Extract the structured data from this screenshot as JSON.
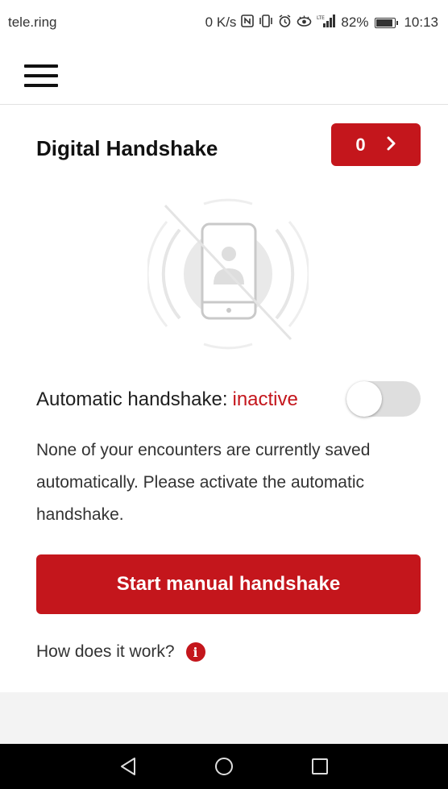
{
  "status_bar": {
    "carrier": "tele.ring",
    "speed": "0 K/s",
    "battery": "82%",
    "time": "10:13",
    "icons": [
      "nfc-icon",
      "vibrate-icon",
      "alarm-icon",
      "eye-comfort-icon",
      "lte-signal-icon",
      "battery-icon"
    ]
  },
  "app_bar": {
    "menu_icon": "hamburger-menu-icon"
  },
  "main": {
    "title": "Digital Handshake",
    "counter": "0",
    "counter_icon": "chevron-right-icon",
    "illustration_icon": "phone-person-crossed-icon",
    "toggle": {
      "label": "Automatic handshake:",
      "status": "inactive",
      "on": false
    },
    "description": "None of your encounters are currently saved automatically. Please activate the automatic handshake.",
    "manual_button": "Start manual handshake",
    "howto": "How does it work?",
    "howto_icon": "info-icon"
  },
  "nav_bar": {
    "back_icon": "back-triangle-icon",
    "home_icon": "home-circle-icon",
    "recents_icon": "recents-square-icon"
  },
  "colors": {
    "accent": "#c4161c",
    "switch_off": "#dedede",
    "footer_band": "#f3f3f3",
    "nav_bar": "#000000"
  }
}
